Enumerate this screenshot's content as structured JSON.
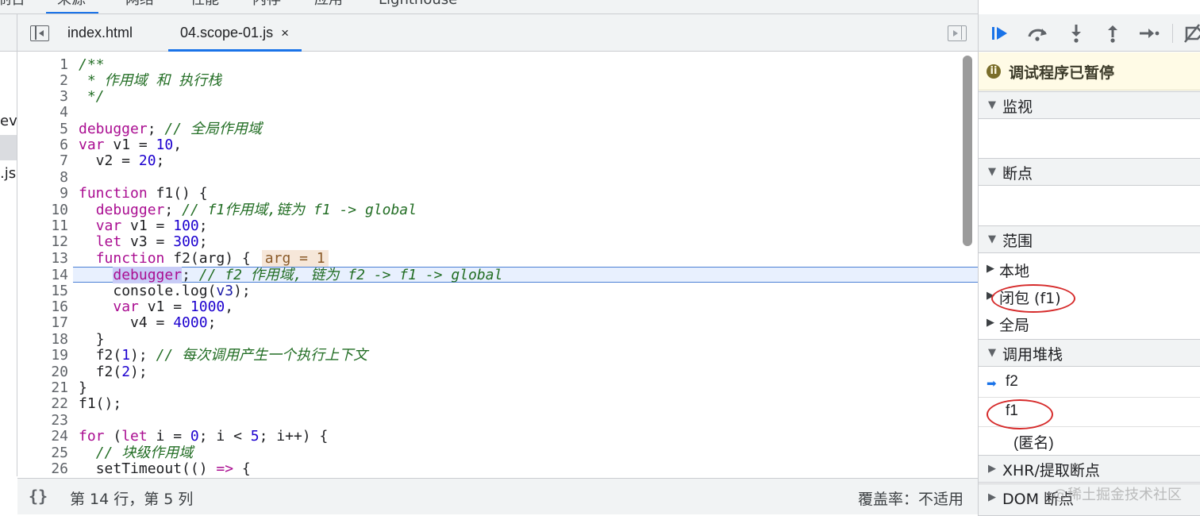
{
  "top_tabs": [
    "制台",
    "来源",
    "网络",
    "性能",
    "内存",
    "应用",
    "Lighthouse"
  ],
  "navigator": {
    "fragment_1": "ev",
    "fragment_2": ".js"
  },
  "file_tabs": {
    "tab1": "index.html",
    "tab2": "04.scope-01.js",
    "close": "×"
  },
  "code": {
    "lines": [
      "1",
      "2",
      "3",
      "4",
      "5",
      "6",
      "7",
      "8",
      "9",
      "10",
      "11",
      "12",
      "13",
      "14",
      "15",
      "16",
      "17",
      "18",
      "19",
      "20",
      "21",
      "22",
      "23",
      "24",
      "25",
      "26"
    ],
    "l1": "/**",
    "l2": " * 作用域 和 执行栈",
    "l3": " */",
    "l5_kw": "debugger",
    "l5_c": "// 全局作用域",
    "l6_a": "var",
    "l6_b": " v1 = ",
    "l6_n": "10",
    "l7_a": "  v2 = ",
    "l7_n": "20",
    "l9_a": "function",
    "l9_b": " f1() {",
    "l10_kw": "debugger",
    "l10_c": "// f1作用域,链为 f1 -> global",
    "l11_a": "var",
    "l11_b": " v1 = ",
    "l11_n": "100",
    "l12_a": "let",
    "l12_b": " v3 = ",
    "l12_n": "300",
    "l13_a": "function",
    "l13_b": " f2(arg) {",
    "l13_inline": "arg = 1",
    "l14_kw": "debugger",
    "l14_c": "// f2 作用域, 链为 f2 -> f1 -> global",
    "l15_a": "console.log(",
    "l15_v": "v3",
    "l15_b": ");",
    "l16_a": "var",
    "l16_b": " v1 = ",
    "l16_n": "1000",
    "l17_a": "v4 = ",
    "l17_n": "4000",
    "l18": "}",
    "l19_a": "f2(",
    "l19_n": "1",
    "l19_c": "// 每次调用产生一个执行上下文",
    "l20_a": "f2(",
    "l20_n": "2",
    "l21": "}",
    "l22": "f1();",
    "l24_a": "for",
    "l24_b": " (",
    "l24_c": "let",
    "l24_d": " i = ",
    "l24_n": "0",
    "l24_e": "; i < ",
    "l24_n2": "5",
    "l24_f": "; i++) {",
    "l25_c": "// 块级作用域",
    "l26_a": "setTimeout(() ",
    "l26_k": "=>",
    "l26_b": " {"
  },
  "status": {
    "braces": "{}",
    "position": "第 14 行，第 5 列",
    "coverage": "覆盖率：不适用"
  },
  "debugger": {
    "paused_icon": "ii",
    "paused": "调试程序已暂停",
    "watch": "监视",
    "breakpoints": "断点",
    "scope": "范围",
    "scope_items": [
      "本地",
      "闭包 (f1)",
      "全局"
    ],
    "call_stack": "调用堆栈",
    "frames": [
      "f2",
      "f1",
      "(匿名)"
    ],
    "xhr": "XHR/提取断点",
    "dom": "DOM 断点"
  },
  "watermark": "@稀土掘金技术社区",
  "colors": {
    "accent": "#1a73e8",
    "annotation": "#d62b2b",
    "keyword": "#aa0d91",
    "comment": "#236e25",
    "number": "#1c00cf"
  }
}
